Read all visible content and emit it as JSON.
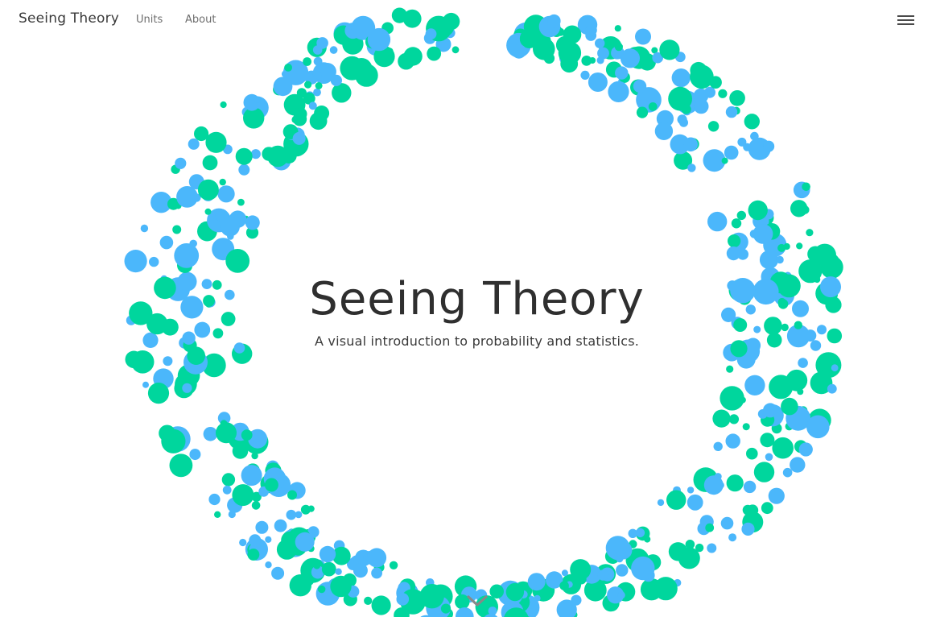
{
  "nav": {
    "brand": "Seeing Theory",
    "links": [
      "Units",
      "About"
    ],
    "menu_icon": "hamburger-menu-icon"
  },
  "hero": {
    "title": "Seeing Theory",
    "subtitle": "A visual introduction to probability and statistics."
  },
  "scroll_icon": "chevron-down-icon",
  "colors": {
    "green": "#00d69d",
    "blue": "#4bb7fb",
    "text": "#2f2f2f",
    "nav_text": "#6e6e6e",
    "chevron": "#888888"
  }
}
